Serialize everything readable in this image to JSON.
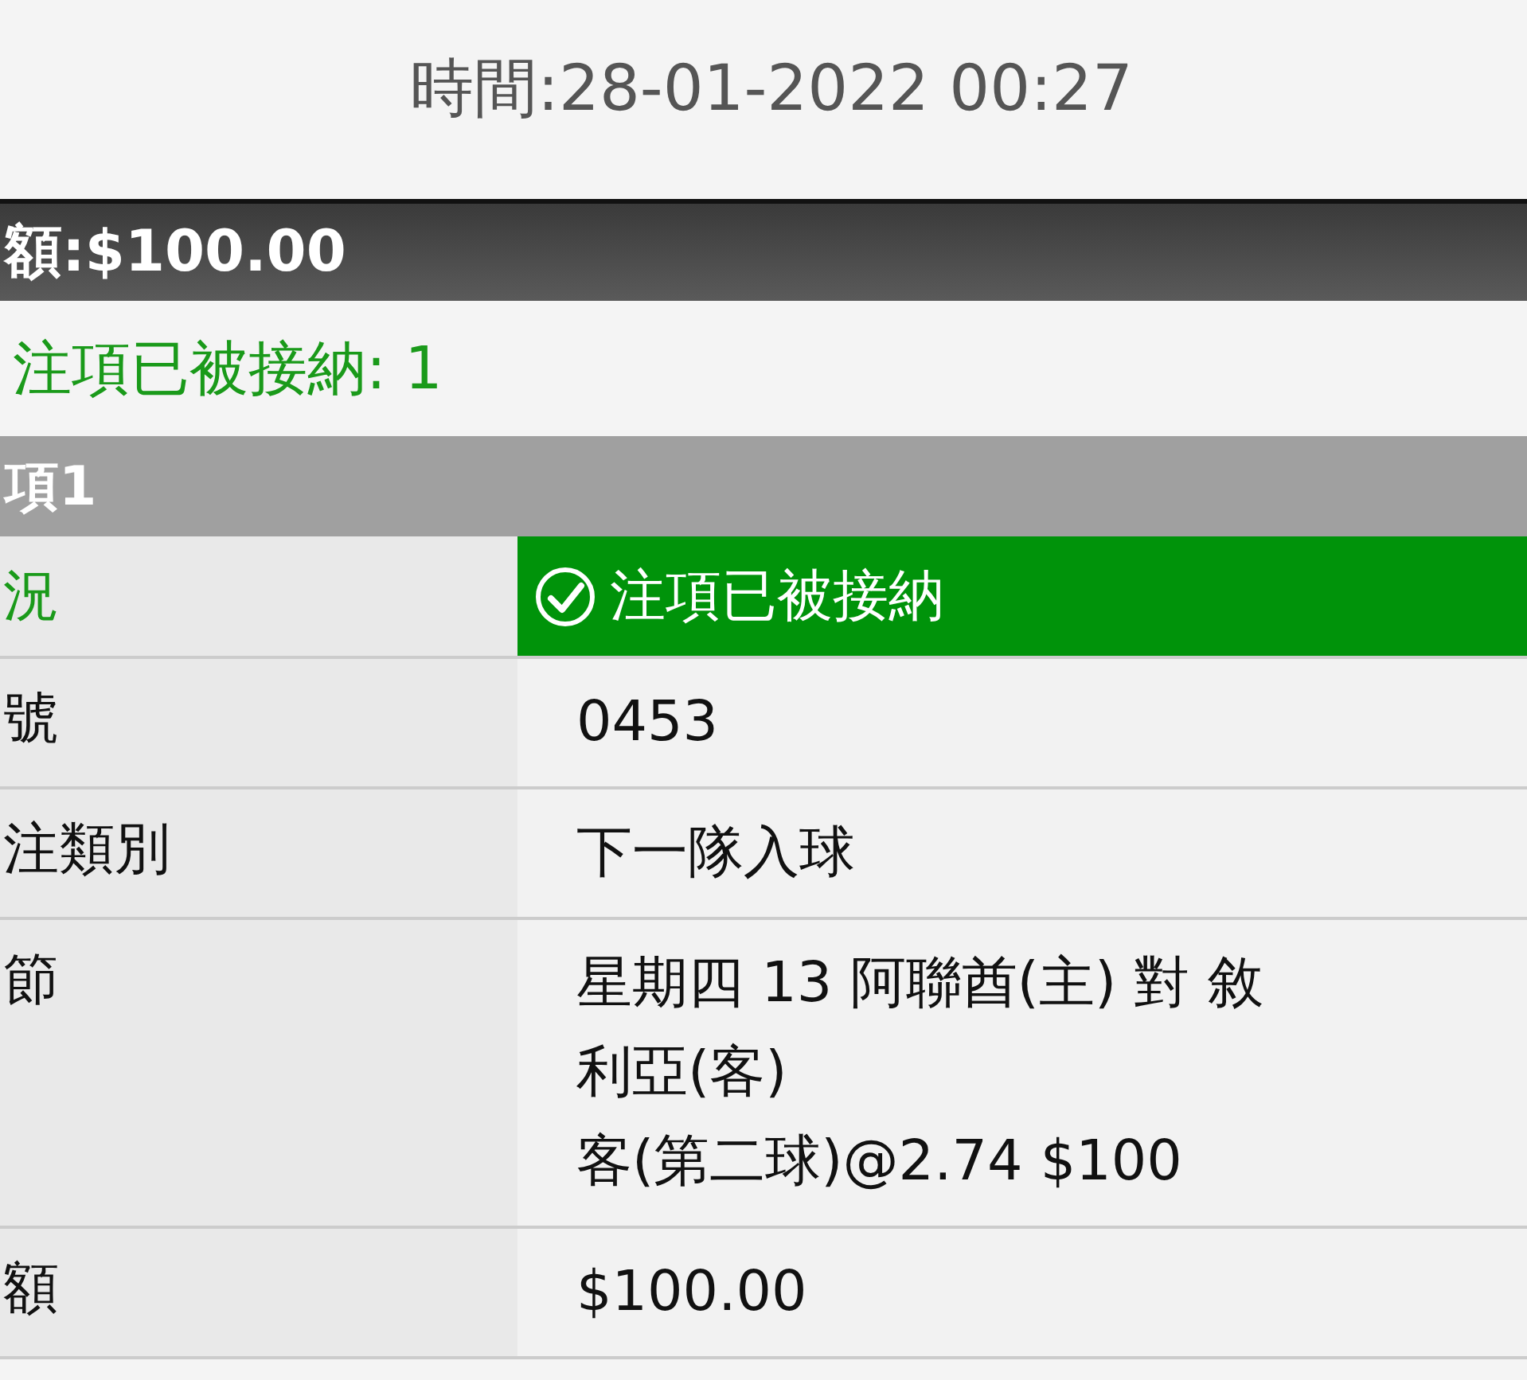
{
  "time": "時間:28-01-2022 00:27",
  "total_bar": "額:$100.00",
  "accepted_summary": "注項已被接納: 1",
  "bet_header": "項1",
  "rows": [
    {
      "kind": "status",
      "label": "況",
      "lines": [
        "注項已被接納"
      ]
    },
    {
      "kind": "text",
      "label": "號",
      "lines": [
        "0453"
      ]
    },
    {
      "kind": "text",
      "label": "注類別",
      "lines": [
        "下一隊入球"
      ]
    },
    {
      "kind": "text",
      "label": "節",
      "lines": [
        "星期四 13 阿聯酋(主) 對 敘",
        "利亞(客)",
        "客(第二球)@2.74 $100"
      ]
    },
    {
      "kind": "text",
      "label": "額",
      "lines": [
        "$100.00"
      ]
    }
  ]
}
